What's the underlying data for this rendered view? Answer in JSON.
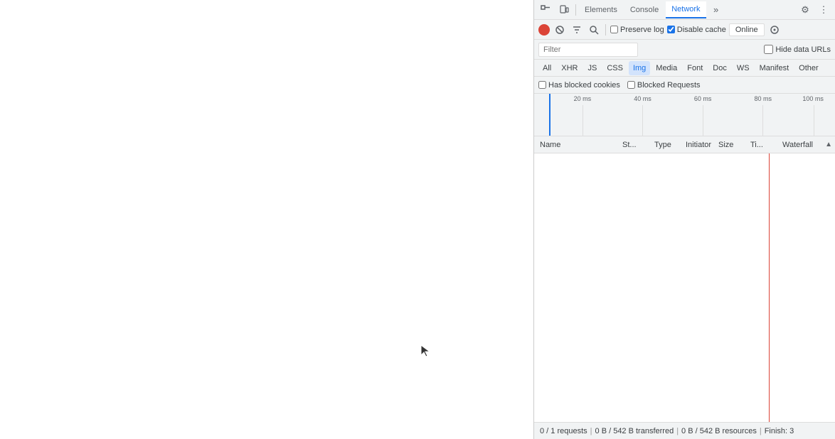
{
  "main": {
    "background": "#ffffff"
  },
  "devtools": {
    "tabs": [
      {
        "id": "elements",
        "label": "Elements",
        "active": false
      },
      {
        "id": "console",
        "label": "Console",
        "active": false
      },
      {
        "id": "network",
        "label": "Network",
        "active": true
      }
    ],
    "toolbar": {
      "inspect_icon": "⬚",
      "device_icon": "▭",
      "more_icon": "»",
      "settings_icon": "⚙",
      "menu_icon": "⋮"
    },
    "network": {
      "preserve_log_label": "Preserve log",
      "disable_cache_label": "Disable cache",
      "online_label": "Online",
      "filter_placeholder": "Filter",
      "hide_data_urls_label": "Hide data URLs",
      "type_filters": [
        "All",
        "XHR",
        "JS",
        "CSS",
        "Img",
        "Media",
        "Font",
        "Doc",
        "WS",
        "Manifest",
        "Other"
      ],
      "active_type": "Img",
      "has_blocked_cookies_label": "Has blocked cookies",
      "blocked_requests_label": "Blocked Requests",
      "timeline": {
        "markers": [
          {
            "label": "20 ms",
            "position": 16
          },
          {
            "label": "40 ms",
            "position": 36
          },
          {
            "label": "60 ms",
            "position": 56
          },
          {
            "label": "80 ms",
            "position": 76
          },
          {
            "label": "100 ms",
            "position": 96
          }
        ]
      },
      "columns": [
        {
          "id": "name",
          "label": "Name"
        },
        {
          "id": "status",
          "label": "St..."
        },
        {
          "id": "type",
          "label": "Type"
        },
        {
          "id": "initiator",
          "label": "Initiator"
        },
        {
          "id": "size",
          "label": "Size"
        },
        {
          "id": "time",
          "label": "Ti..."
        },
        {
          "id": "waterfall",
          "label": "Waterfall"
        }
      ],
      "status_bar": {
        "requests": "0 / 1 requests",
        "transferred": "0 B / 542 B transferred",
        "resources": "0 B / 542 B resources",
        "finish": "Finish: 3"
      }
    }
  }
}
